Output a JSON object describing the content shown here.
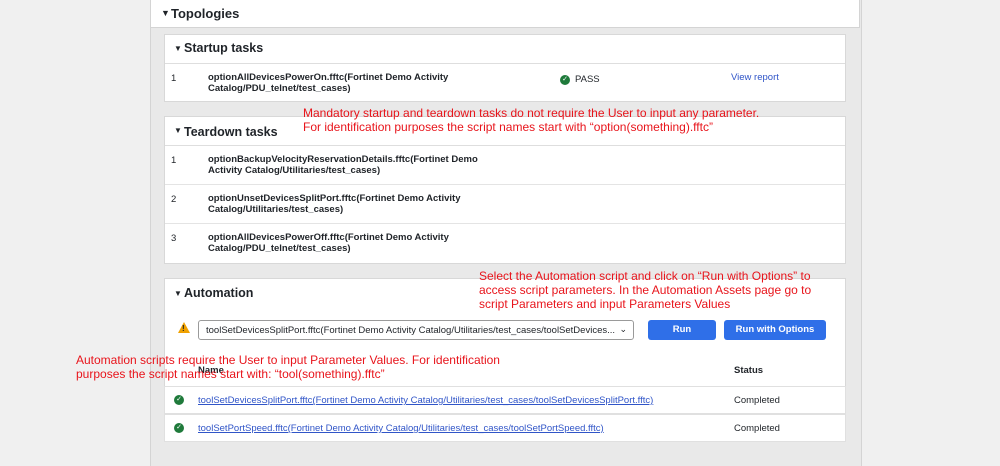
{
  "topologies": {
    "label": "Topologies"
  },
  "startup": {
    "title": "Startup tasks",
    "rows": [
      {
        "num": "1",
        "name": "optionAllDevicesPowerOn.fftc(Fortinet Demo Activity Catalog/PDU_telnet/test_cases)",
        "status": "PASS",
        "action": "View report"
      }
    ]
  },
  "teardown": {
    "title": "Teardown tasks",
    "rows": [
      {
        "num": "1",
        "name": "optionBackupVelocityReservationDetails.fftc(Fortinet Demo Activity Catalog/Utilitaries/test_cases)"
      },
      {
        "num": "2",
        "name": "optionUnsetDevicesSplitPort.fftc(Fortinet Demo Activity Catalog/Utilitaries/test_cases)"
      },
      {
        "num": "3",
        "name": "optionAllDevicesPowerOff.fftc(Fortinet Demo Activity Catalog/PDU_telnet/test_cases)"
      }
    ]
  },
  "automation": {
    "title": "Automation",
    "select_value": "toolSetDevicesSplitPort.fftc(Fortinet Demo Activity Catalog/Utilitaries/test_cases/toolSetDevices...",
    "run_label": "Run",
    "run_options_label": "Run with Options",
    "col_name": "Name",
    "col_status": "Status",
    "rows": [
      {
        "name": "toolSetDevicesSplitPort.fftc(Fortinet Demo Activity Catalog/Utilitaries/test_cases/toolSetDevicesSplitPort.fftc)",
        "status": "Completed"
      },
      {
        "name": "toolSetPortSpeed.fftc(Fortinet Demo Activity Catalog/Utilitaries/test_cases/toolSetPortSpeed.fftc)",
        "status": "Completed"
      }
    ]
  },
  "annotations": {
    "mandatory_1": "Mandatory startup and teardown tasks do not require the User to input any parameter.",
    "mandatory_2": "For identification purposes the script names start with “option(something).fftc”",
    "select_1": "Select the Automation script and click on “Run with Options” to",
    "select_2": "access script parameters. In the Automation Assets page go to",
    "select_3": "script Parameters and input Parameters Values",
    "auto_1": "Automation scripts require the User to input Parameter Values. For identification",
    "auto_2": "purposes the script names start with: “tool(something).fftc”"
  },
  "colors": {
    "accent": "#2f6fe8",
    "pass": "#1f7a3b",
    "annotation": "#e8141b",
    "warning": "#f0a100"
  }
}
